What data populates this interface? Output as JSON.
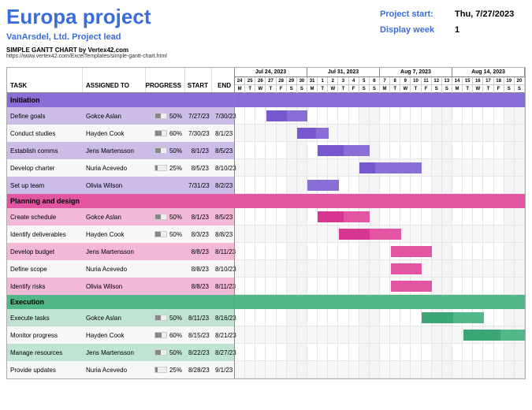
{
  "header": {
    "title": "Europa project",
    "subtitle": "VanArsdel, Ltd.   Project lead",
    "project_start_label": "Project start:",
    "project_start_value": "Thu, 7/27/2023",
    "display_week_label": "Display week",
    "display_week_value": "1",
    "attr1": "SIMPLE GANTT CHART by Vertex42.com",
    "attr2": "https://www.vertex42.com/ExcelTemplates/simple-gantt-chart.html"
  },
  "columns": {
    "task": "TASK",
    "assigned": "ASSIGNED TO",
    "progress": "PROGRESS",
    "start": "START",
    "end": "END"
  },
  "chart_data": {
    "type": "table",
    "calendar": {
      "start": "2023-07-24",
      "end": "2023-08-20",
      "weeks": [
        "Jul 24, 2023",
        "Jul 31, 2023",
        "Aug 7, 2023",
        "Aug 14, 2023"
      ],
      "days": [
        24,
        25,
        26,
        27,
        28,
        29,
        30,
        31,
        1,
        2,
        3,
        4,
        5,
        6,
        7,
        8,
        9,
        10,
        11,
        12,
        13,
        14,
        15,
        16,
        17,
        18,
        19,
        20
      ],
      "dow": [
        "M",
        "T",
        "W",
        "T",
        "F",
        "S",
        "S",
        "M",
        "T",
        "W",
        "T",
        "F",
        "S",
        "S",
        "M",
        "T",
        "W",
        "T",
        "F",
        "S",
        "S",
        "M",
        "T",
        "W",
        "T",
        "F",
        "S",
        "S"
      ]
    },
    "phases": [
      {
        "name": "Initiation",
        "color": 0,
        "tasks": [
          {
            "task": "Define goals",
            "assigned": "Gokce Aslan",
            "progress": 50,
            "start": "7/27/23",
            "end": "7/30/23",
            "si": 3,
            "len": 4
          },
          {
            "task": "Conduct studies",
            "assigned": "Hayden Cook",
            "progress": 60,
            "start": "7/30/23",
            "end": "8/1/23",
            "si": 6,
            "len": 3
          },
          {
            "task": "Establish comms",
            "assigned": "Jens Martensson",
            "progress": 50,
            "start": "8/1/23",
            "end": "8/5/23",
            "si": 8,
            "len": 5
          },
          {
            "task": "Develop charter",
            "assigned": "Nuria Acevedo",
            "progress": 25,
            "start": "8/5/23",
            "end": "8/10/23",
            "si": 12,
            "len": 6
          },
          {
            "task": "Set up team",
            "assigned": "Olivia Wilson",
            "progress": null,
            "start": "7/31/23",
            "end": "8/2/23",
            "si": 7,
            "len": 3
          }
        ]
      },
      {
        "name": "Planning and design",
        "color": 1,
        "tasks": [
          {
            "task": "Create schedule",
            "assigned": "Gokce Aslan",
            "progress": 50,
            "start": "8/1/23",
            "end": "8/5/23",
            "si": 8,
            "len": 5
          },
          {
            "task": "Identify deliverables",
            "assigned": "Hayden Cook",
            "progress": 50,
            "start": "8/3/23",
            "end": "8/8/23",
            "si": 10,
            "len": 6
          },
          {
            "task": "Develop budget",
            "assigned": "Jens Martensson",
            "progress": null,
            "start": "8/8/23",
            "end": "8/11/23",
            "si": 15,
            "len": 4
          },
          {
            "task": "Define scope",
            "assigned": "Nuria Acevedo",
            "progress": null,
            "start": "8/8/23",
            "end": "8/10/23",
            "si": 15,
            "len": 3
          },
          {
            "task": "Identify risks",
            "assigned": "Olivia Wilson",
            "progress": null,
            "start": "8/8/23",
            "end": "8/11/23",
            "si": 15,
            "len": 4
          }
        ]
      },
      {
        "name": "Execution",
        "color": 2,
        "tasks": [
          {
            "task": "Execute tasks",
            "assigned": "Gokce Aslan",
            "progress": 50,
            "start": "8/11/23",
            "end": "8/16/23",
            "si": 18,
            "len": 6
          },
          {
            "task": "Monitor progress",
            "assigned": "Hayden Cook",
            "progress": 60,
            "start": "8/15/23",
            "end": "8/21/23",
            "si": 22,
            "len": 6
          },
          {
            "task": "Manage resources",
            "assigned": "Jens Martensson",
            "progress": 50,
            "start": "8/22/23",
            "end": "8/27/23",
            "si": 29,
            "len": 6
          },
          {
            "task": "Provide updates",
            "assigned": "Nuria Acevedo",
            "progress": 25,
            "start": "8/28/23",
            "end": "9/1/23",
            "si": 35,
            "len": 5
          }
        ]
      }
    ]
  }
}
